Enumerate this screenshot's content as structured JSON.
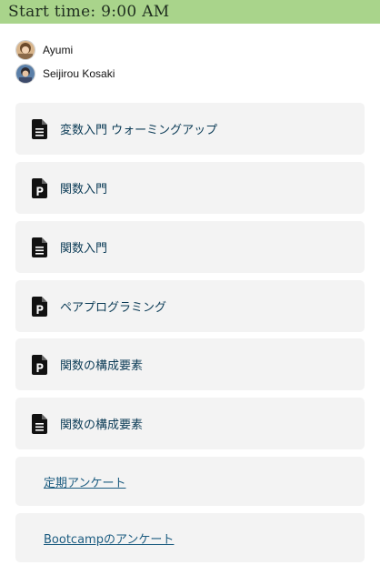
{
  "header": {
    "start_time": "Start time: 9:00 AM"
  },
  "participants": [
    {
      "name": "Ayumi",
      "avatar": "ayumi-avatar"
    },
    {
      "name": "Seijirou Kosaki",
      "avatar": "seijirou-avatar"
    }
  ],
  "items": [
    {
      "type": "document",
      "icon": "document-icon",
      "label": "変数入門 ウォーミングアップ"
    },
    {
      "type": "presentation",
      "icon": "presentation-icon",
      "label": "関数入門"
    },
    {
      "type": "document",
      "icon": "document-icon",
      "label": "関数入門"
    },
    {
      "type": "presentation",
      "icon": "presentation-icon",
      "label": "ペアプログラミング"
    },
    {
      "type": "presentation",
      "icon": "presentation-icon",
      "label": "関数の構成要素"
    },
    {
      "type": "document",
      "icon": "document-icon",
      "label": "関数の構成要素"
    }
  ],
  "links": [
    {
      "label": "定期アンケート"
    },
    {
      "label": "Bootcampのアンケート"
    }
  ],
  "colors": {
    "header_bg": "#a9d48b",
    "card_bg": "#f3f3f3",
    "item_text": "#0b3b56",
    "link_text": "#1c5c80"
  }
}
